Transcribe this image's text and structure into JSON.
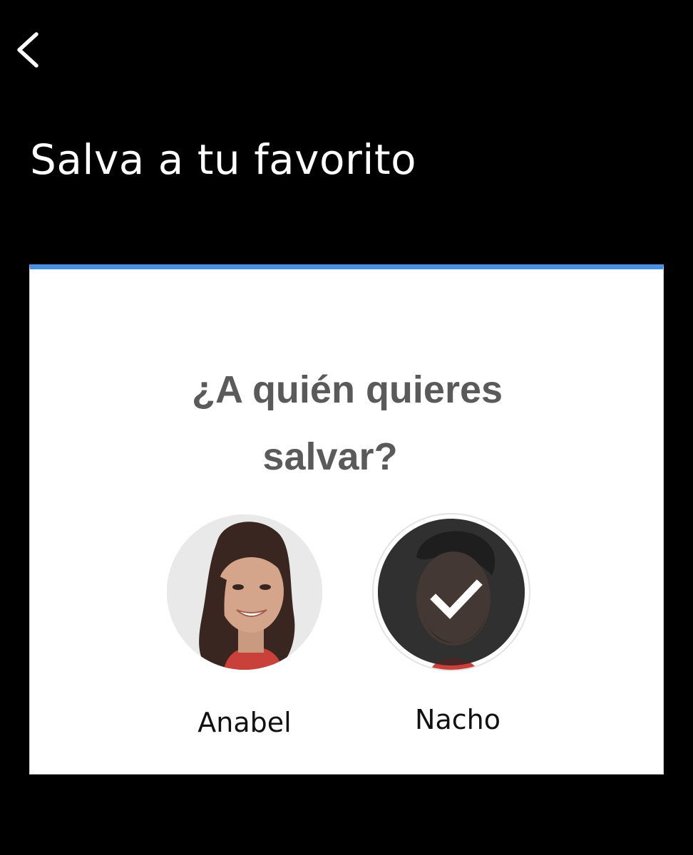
{
  "header": {
    "back_icon": "chevron-left-icon",
    "title": "Salva a tu favorito"
  },
  "poll": {
    "accent_color": "#4a90e2",
    "question_line_1": "¿A quién quieres",
    "question_line_2": "salvar?",
    "options": [
      {
        "name": "Anabel",
        "selected": false
      },
      {
        "name": "Nacho",
        "selected": true,
        "selected_icon": "checkmark-icon"
      }
    ]
  }
}
